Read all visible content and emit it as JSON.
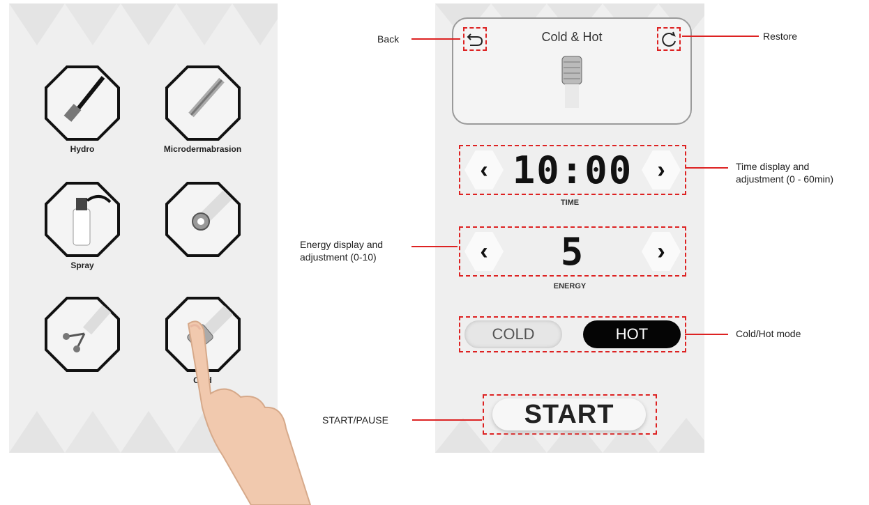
{
  "left_menu": {
    "items": [
      {
        "label": "Hydro",
        "icon": "hydro-handpiece-icon"
      },
      {
        "label": "Microdermabrasion",
        "icon": "microdermabrasion-wand-icon"
      },
      {
        "label": "Spray",
        "icon": "spray-bottle-icon"
      },
      {
        "label": "",
        "icon": "roller-handpiece-icon"
      },
      {
        "label": "",
        "icon": "dual-ball-handpiece-icon"
      },
      {
        "label": "Cold",
        "icon": "cold-hot-handpiece-icon"
      }
    ]
  },
  "screen": {
    "title": "Cold & Hot",
    "time": {
      "value": "10:00",
      "caption": "TIME"
    },
    "energy": {
      "value": "5",
      "caption": "ENERGY"
    },
    "mode": {
      "cold_label": "COLD",
      "hot_label": "HOT",
      "selected": "HOT"
    },
    "start_label": "START"
  },
  "annotations": {
    "back": "Back",
    "restore": "Restore",
    "time_line1": "Time display and",
    "time_line2": "adjustment  (0 - 60min)",
    "energy_line1": "Energy display and",
    "energy_line2": "adjustment  (0-10)",
    "mode": "Cold/Hot mode",
    "start": "START/PAUSE"
  },
  "colors": {
    "callout": "#d22222",
    "hot_bg": "#050505"
  }
}
